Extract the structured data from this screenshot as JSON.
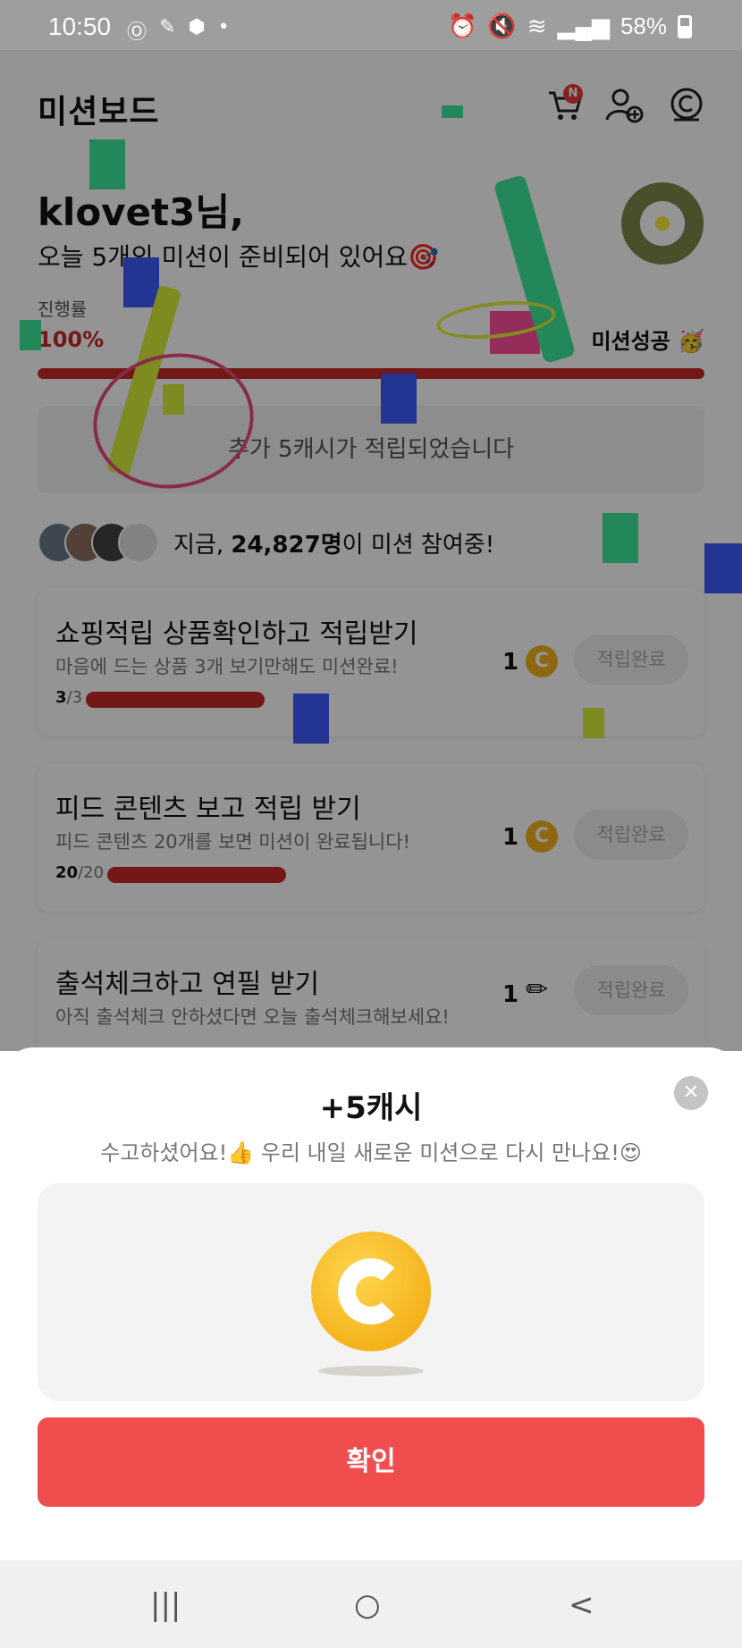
{
  "status": {
    "time": "10:50",
    "battery": "58%",
    "icons_left": [
      "oh-icon",
      "pen-icon",
      "box-icon",
      "dot-icon"
    ],
    "icons_right": [
      "alarm-icon",
      "mute-icon",
      "wifi-icon",
      "hd-voice-icon",
      "signal-icon",
      "battery-icon"
    ]
  },
  "header": {
    "title": "미션보드",
    "cart_badge": "N"
  },
  "greeting": {
    "name": "klovet3님,",
    "subtitle": "오늘 5개의 미션이 준비되어 있어요🎯"
  },
  "progress": {
    "label": "진행률",
    "value": "100%",
    "fraction": 1.0,
    "success_text": "미션성공 🥳"
  },
  "notice": "추가 5캐시가 적립되었습니다",
  "participants": {
    "prefix": "지금, ",
    "count": "24,827명",
    "suffix": "이 미션 참여중!"
  },
  "missions": [
    {
      "title": "쇼핑적립 상품확인하고 적립받기",
      "desc": "마음에 드는 상품 3개 보기만해도 미션완료!",
      "done": "3",
      "total": "/3",
      "reward": "1",
      "reward_icon": "coin-icon",
      "button": "적립완료",
      "progress": 1.0
    },
    {
      "title": "피드 콘텐츠 보고 적립 받기",
      "desc": "피드 콘텐츠 20개를 보면 미션이 완료됩니다!",
      "done": "20",
      "total": "/20",
      "reward": "1",
      "reward_icon": "coin-icon",
      "button": "적립완료",
      "progress": 1.0
    },
    {
      "title": "출석체크하고 연필 받기",
      "desc": "아직 출석체크 안하셨다면 오늘 출석체크해보세요!",
      "reward": "1",
      "reward_icon": "pencil-icon",
      "button": "적립완료"
    }
  ],
  "sheet": {
    "title": "+5캐시",
    "message": "수고하셨어요!👍 우리 내일 새로운 미션으로 다시 만나요!😍",
    "confirm": "확인"
  },
  "navbar": {
    "recent": "|||",
    "home": "○",
    "back": "<"
  },
  "colors": {
    "accent_red": "#f04e4e",
    "progress_red": "#c62828",
    "coin_yellow": "#f4b31c"
  }
}
